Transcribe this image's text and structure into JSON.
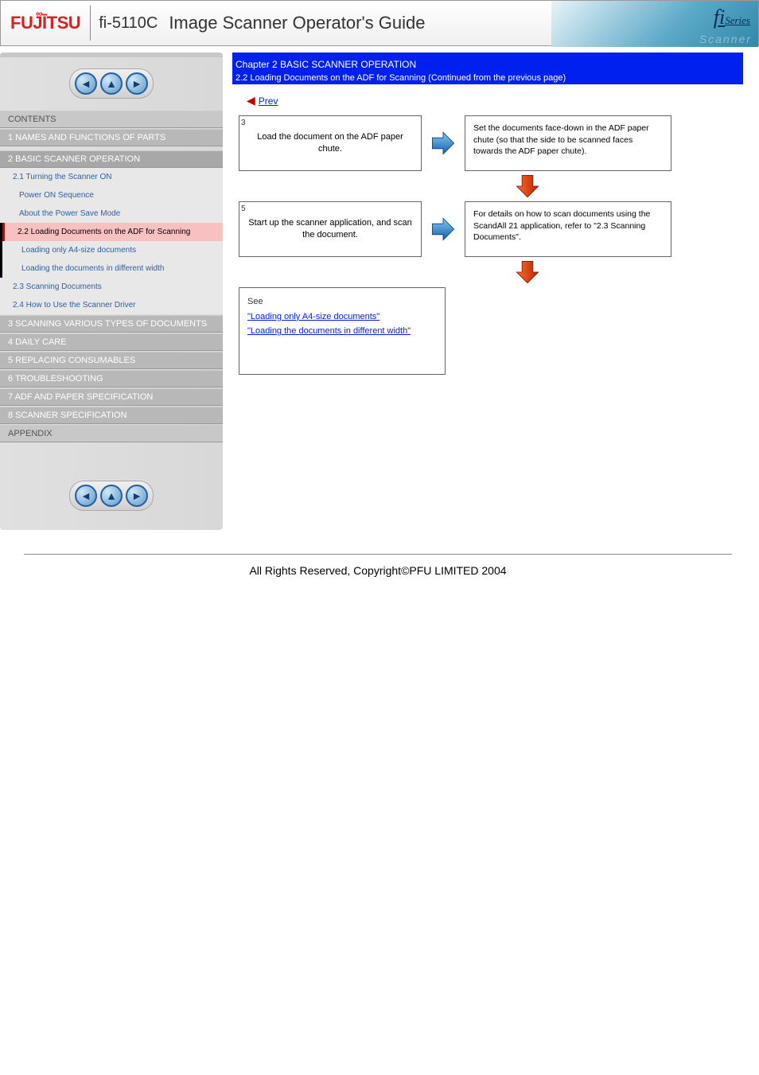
{
  "brand": "FUJITSU",
  "model": "fi-5110C",
  "title": "Image Scanner Operator's Guide",
  "series_badge": {
    "fi": "fi",
    "series": "Series",
    "scanner": "Scanner"
  },
  "sidebar": {
    "contents": "CONTENTS",
    "sections": [
      {
        "label": "1 NAMES AND FUNCTIONS OF PARTS"
      },
      {
        "label": "2 BASIC SCANNER OPERATION"
      }
    ],
    "submenu": [
      {
        "label": "2.1 Turning the Scanner ON",
        "active": false
      },
      {
        "label": "Power ON Sequence",
        "active": false,
        "sub": true
      },
      {
        "label": "About the Power Save Mode",
        "active": false,
        "sub": true
      },
      {
        "label": "2.2 Loading Documents on the ADF for Scanning",
        "active": true
      },
      {
        "label": "Loading only A4-size documents",
        "active": false,
        "sub": true
      },
      {
        "label": "Loading the documents in different width",
        "active": false,
        "sub": true
      },
      {
        "label": "2.3 Scanning Documents",
        "active": false
      },
      {
        "label": "2.4 How to Use the Scanner Driver",
        "active": false
      }
    ],
    "more_sections": [
      {
        "label": "3 SCANNING VARIOUS TYPES OF DOCUMENTS"
      },
      {
        "label": "4 DAILY CARE"
      },
      {
        "label": "5 REPLACING CONSUMABLES"
      },
      {
        "label": "6 TROUBLESHOOTING"
      },
      {
        "label": "7 ADF AND PAPER SPECIFICATION"
      },
      {
        "label": "8 SCANNER SPECIFICATION"
      },
      {
        "label": "APPENDIX"
      }
    ]
  },
  "content": {
    "chapter": "Chapter 2 BASIC SCANNER OPERATION",
    "breadcrumb": "2.2 Loading Documents on the ADF for Scanning (Continued from the previous page)",
    "prev": "Prev",
    "flow": [
      {
        "num": "5",
        "left": "Start up the scanner application, and scan the document.",
        "right": "For details on how to scan documents using the ScandAll 21 application, refer to \"2.3 Scanning Documents\"."
      },
      {
        "num": "3",
        "left": "Load the document on the ADF paper chute.",
        "right": "Set the documents face-down in the ADF paper chute (so that the side to be scanned faces towards the ADF paper chute)."
      }
    ],
    "links": {
      "intro": "See",
      "items": [
        "\"Loading only A4-size documents\"",
        "\"Loading the documents in different width\""
      ]
    }
  },
  "footer": "All Rights Reserved, Copyright©PFU LIMITED 2004"
}
